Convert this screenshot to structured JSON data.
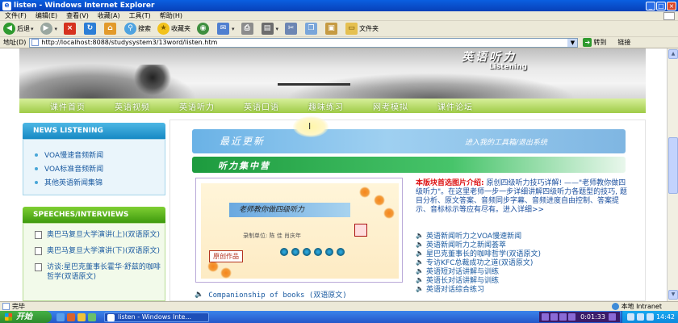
{
  "window": {
    "title": "listen - Windows Internet Explorer",
    "controls": [
      "_",
      "□",
      "×"
    ]
  },
  "menu": [
    "文件(F)",
    "编辑(E)",
    "查看(V)",
    "收藏(A)",
    "工具(T)",
    "帮助(H)"
  ],
  "toolbar": {
    "back": "后退",
    "search": "搜索",
    "favorites": "收藏夹",
    "folders": "文件夹"
  },
  "address": {
    "label": "地址(D)",
    "url": "http://localhost:8088/studysystem3/13word/listen.htm",
    "go": "转到",
    "links": "链接"
  },
  "banner": {
    "title_cn": "英语听力",
    "title_en": "Listening"
  },
  "nav": [
    "课件首页",
    "英语视频",
    "英语听力",
    "英语口语",
    "趣味练习",
    "网考模拟",
    "课件论坛"
  ],
  "sidebar": {
    "news_title": "NEWS LISTENING",
    "news_items": [
      "VOA慢速音频新闻",
      "VOA标准音频新闻",
      "其他英语新闻集锦"
    ],
    "speeches_title": "SPEECHES/INTERVIEWS",
    "speech_items": [
      "奥巴马复旦大学演讲(上)(双语原文)",
      "奥巴马复旦大学演讲(下)(双语原文)",
      "访谈:星巴克董事长霍华·舒兹的咖啡哲学(双语原文)"
    ]
  },
  "main": {
    "latest_title": "最近更新",
    "latest_link": "进入我的工具箱/退出系统",
    "focus_title": "听力集中营",
    "feature_band": "老师教你做四级听力",
    "feature_sig": "录制单位: 陈 佳 肖庆年",
    "feature_tag": "原创作品",
    "intro_head": "本版块首选图片介绍:",
    "intro_text": "——\"老师教你做四级听力\"。在这里老师一步一步详细讲解四级听力各题型的技巧, 题目分析、原文答案、音频同步字幕、音频进度自由控制、答案提示、音标标示等应有尽有。进入详细>>",
    "intro_first": "原创四级听力技巧详解!",
    "news": [
      "英语新闻听力之VOA慢速新闻",
      "英语新闻听力之新闻荟萃",
      "星巴克董事长的咖啡哲学(双语原文)",
      "专访KFC总裁成功之道(双语原文)",
      "英语短对话讲解与训练",
      "英语长对话讲解与训练",
      "英语对话综合练习"
    ],
    "companionship": "Companionship of books (双语原文)"
  },
  "status": {
    "text": "完毕",
    "zone": "本地 Intranet"
  },
  "taskbar": {
    "start": "开始",
    "task": "listen - Windows Inte...",
    "time_player": "0:01:33",
    "clock": "14:42"
  }
}
